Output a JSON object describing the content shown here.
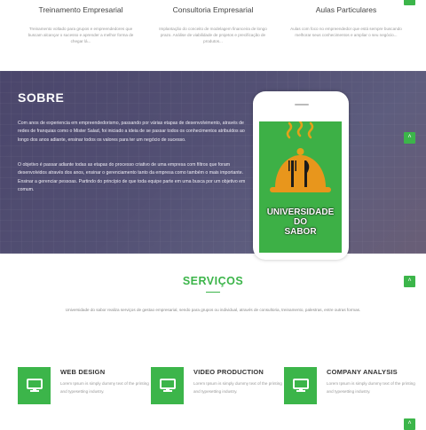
{
  "top_services": [
    {
      "title": "Treinamento Empresarial",
      "desc": "Treinamento voltado para grupos e empreendedores que buscam alcançar o sucesso e aprender a melhor forma de chegar lá..."
    },
    {
      "title": "Consultoria Empresarial",
      "desc": "Implantação do conceito de modelagem financeira de longo prazo. Análise de viabilidade de projetos e precificação de produtos..."
    },
    {
      "title": "Aulas Particulares",
      "desc": "Aulas com foco no empreendedor que está sempre buscando melhorar seus conhecimentos e ampliar o seu negócio..."
    }
  ],
  "sobre": {
    "title": "SOBRE",
    "paragraph1": "Com anos de experiencia em empreendedorismo, passando por várias etapas de desenvolvimento, através de redes de franquias como o Mister Salad, foi iniciado a ideia de se passar todos os conhecimentos atribuídos ao longo dos anos adiante, ensinar todos os valores para ter um negócio de sucesso.",
    "paragraph2": "O objetivo é passar adiante todas as etapas do processo criativo de uma empresa com filtros que foram desenvolvidos através dos anos, ensinar o gerenciamento tanto da empresa como também o mais importante. Ensinar a gerenciar pessoas. Partindo do princípio de que toda equipe parte em uma busca por um objetivo em comum."
  },
  "logo": {
    "line1": "UNIVERSIDADE",
    "line2": "DO",
    "line3": "SABOR"
  },
  "servicos": {
    "title": "SERVIÇOS",
    "subtitle": "Universidade do sabor realiza serviços de gestao empresarial, sendo para grupos ou individual, através de consultoria, treinamento, palestras, entre outras formas."
  },
  "features": [
    {
      "title": "WEB DESIGN",
      "desc": "Lorem Ipsum is simply dummy text of the printing and typesetting industry."
    },
    {
      "title": "VIDEO PRODUCTION",
      "desc": "Lorem Ipsum is simply dummy text of the printing and typesetting industry."
    },
    {
      "title": "COMPANY ANALYSIS",
      "desc": "Lorem Ipsum is simply dummy text of the printing and typesetting industry."
    }
  ],
  "icons": {
    "scroll_up": "chevron-up-icon",
    "feature": "monitor-icon"
  },
  "colors": {
    "accent": "#3cb54a",
    "sobre_bg": "#5b5a7d"
  }
}
